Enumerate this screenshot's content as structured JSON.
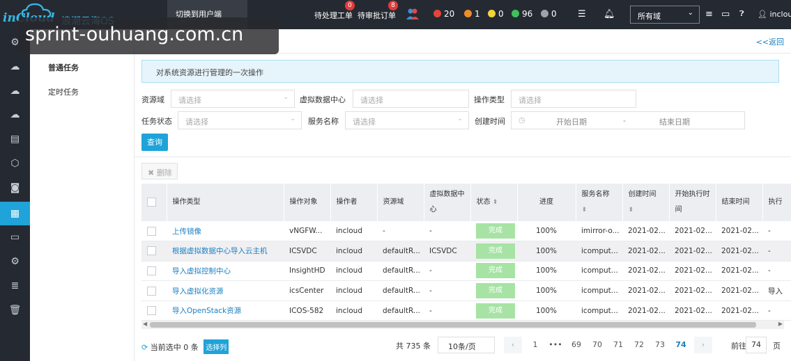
{
  "top": {
    "logo_en": "inCloud",
    "logo_cn": "浪潮云海OS",
    "switch_portal": "切换到用户端",
    "pending_tickets_label": "待处理工单",
    "pending_tickets_count": "0",
    "pending_orders_label": "待审批订单",
    "pending_orders_count": "8",
    "alarms": [
      {
        "color": "#e5443b",
        "value": "20",
        "icon": "fire-icon"
      },
      {
        "color": "#f08c2a",
        "value": "1",
        "icon": "warning-icon"
      },
      {
        "color": "#f2d33a",
        "value": "0",
        "icon": "minor-alert-icon"
      },
      {
        "color": "#3cc25b",
        "value": "96",
        "icon": "check-icon"
      },
      {
        "color": "#9ea3ab",
        "value": "0",
        "icon": "unknown-icon"
      }
    ],
    "domain_select": "所有域",
    "user": "inclou"
  },
  "watermark": "sprint-ouhuang.com.cn",
  "subnav": {
    "items": [
      "普通任务",
      "定时任务"
    ]
  },
  "main": {
    "back": "<<返回",
    "info": "对系统资源进行管理的一次操作",
    "filters": {
      "resource_domain_label": "资源域",
      "resource_domain_placeholder": "请选择",
      "vdc_label": "虚拟数据中心",
      "vdc_placeholder": "请选择",
      "op_type_label": "操作类型",
      "op_type_placeholder": "请选择",
      "task_status_label": "任务状态",
      "task_status_placeholder": "请选择",
      "service_label": "服务名称",
      "service_placeholder": "请选择",
      "created_label": "创建时间",
      "start_date": "开始日期",
      "range_sep": "-",
      "end_date": "结束日期"
    },
    "query_btn": "查询",
    "delete_btn": "删除"
  },
  "table": {
    "headers": [
      "操作类型",
      "操作对象",
      "操作者",
      "资源域",
      "虚拟数据中心",
      "状态",
      "进度",
      "服务名称",
      "创建时间",
      "开始执行时间",
      "结束时间",
      "执行"
    ],
    "rows": [
      [
        "上传镜像",
        "vNGFW...",
        "incloud",
        "-",
        "-",
        "完成",
        "100%",
        "imirror-o...",
        "2021-02...",
        "2021-02...",
        "2021-02...",
        "-"
      ],
      [
        "根据虚拟数据中心导入云主机",
        "ICSVDC",
        "incloud",
        "defaultR...",
        "ICSVDC",
        "完成",
        "100%",
        "icomput...",
        "2021-02...",
        "2021-02...",
        "2021-02...",
        "-"
      ],
      [
        "导入虚拟控制中心",
        "InsightHD",
        "incloud",
        "defaultR...",
        "-",
        "完成",
        "100%",
        "icomput...",
        "2021-02...",
        "2021-02...",
        "2021-02...",
        "-"
      ],
      [
        "导入虚拟化资源",
        "icsCenter",
        "incloud",
        "defaultR...",
        "-",
        "完成",
        "100%",
        "icomput...",
        "2021-02...",
        "2021-02...",
        "2021-02...",
        "导入"
      ],
      [
        "导入OpenStack资源",
        "ICOS-582",
        "incloud",
        "defaultR...",
        "-",
        "完成",
        "100%",
        "icomput...",
        "2021-02...",
        "2021-02...",
        "2021-02...",
        "-"
      ]
    ]
  },
  "footer": {
    "selected": "当前选中 0 条",
    "select_columns": "选择列",
    "total": "共 735 条",
    "page_size": "10条/页",
    "pages": [
      "1",
      "•••",
      "69",
      "70",
      "71",
      "72",
      "73",
      "74"
    ],
    "current_page": "74",
    "goto_label": "前往",
    "goto_value": "74",
    "goto_suffix": "页"
  }
}
